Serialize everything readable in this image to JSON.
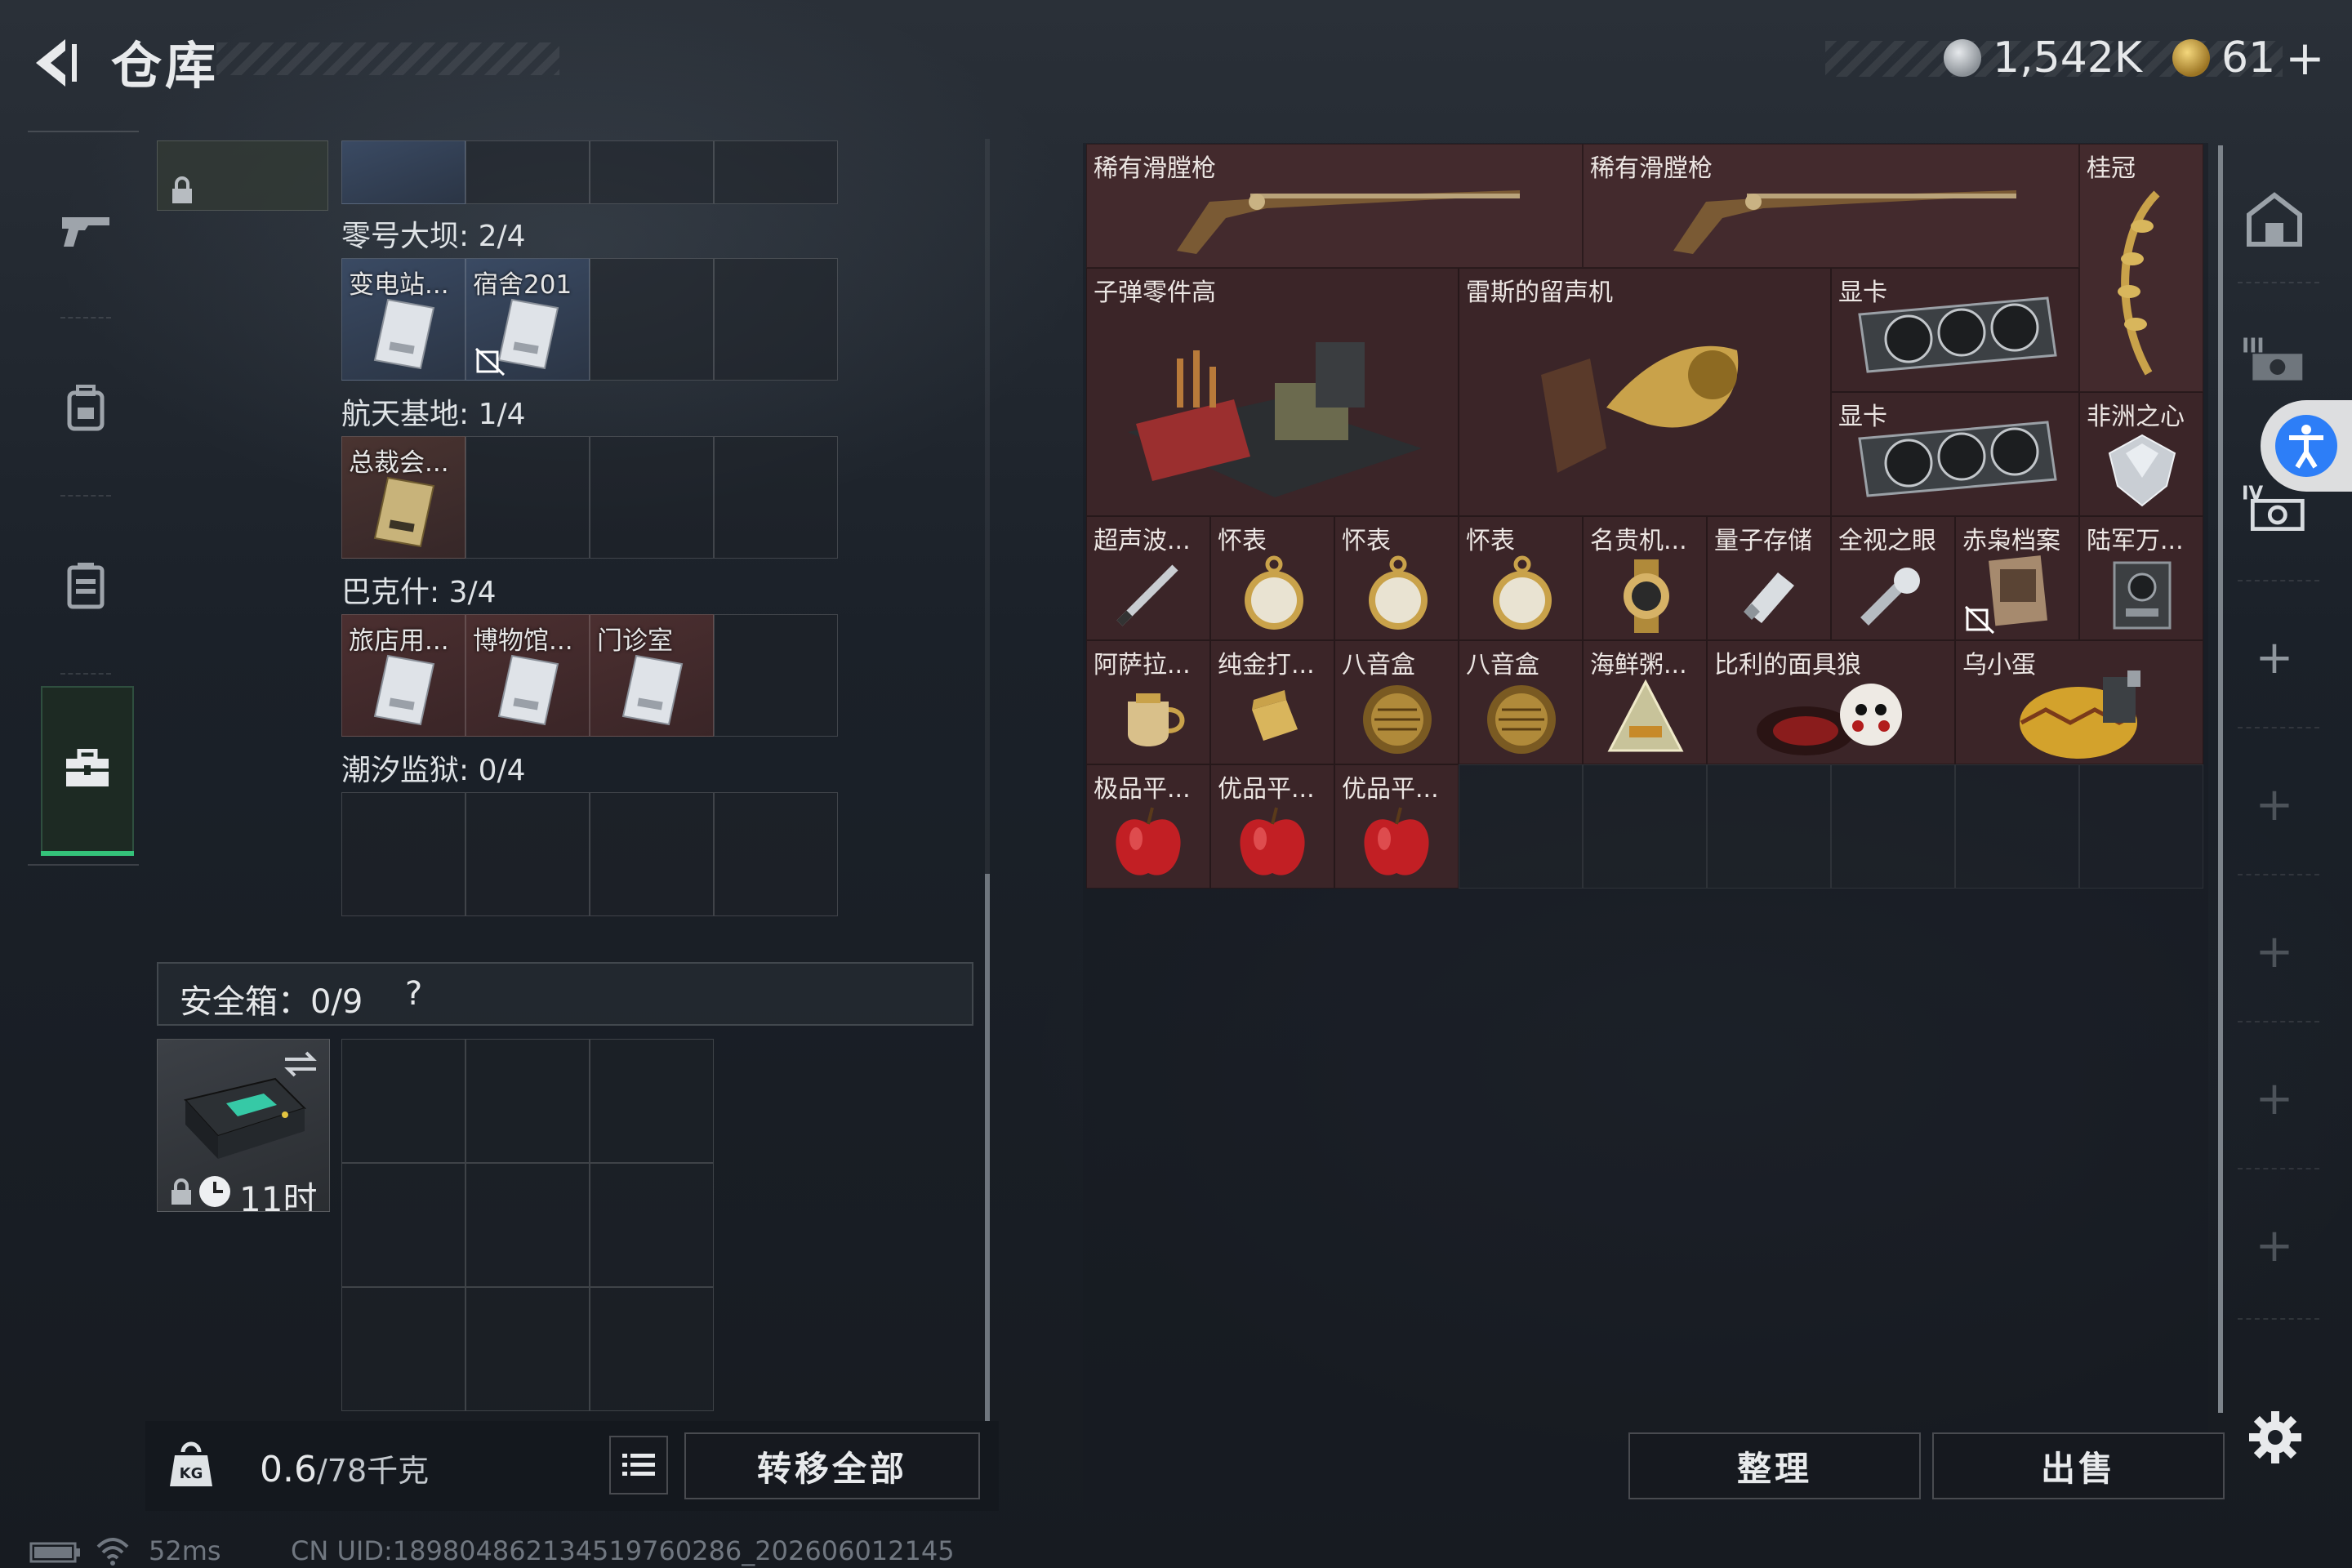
{
  "header": {
    "title": "仓库",
    "currency1": "1,542K",
    "currency2": "61",
    "add_symbol": "+"
  },
  "left_nav": {
    "tabs": [
      "gun-icon",
      "backpack-icon",
      "vest-icon",
      "toolbox-icon"
    ],
    "active": 3
  },
  "keycard_sections": [
    {
      "label": "零号大坝: 2/4",
      "items": [
        "变电站...",
        "宿舍201"
      ]
    },
    {
      "label": "航天基地: 1/4",
      "items": [
        "总裁会..."
      ]
    },
    {
      "label": "巴克什: 3/4",
      "items": [
        "旅店用...",
        "博物馆...",
        "门诊室"
      ]
    },
    {
      "label": "潮汐监狱: 0/4",
      "items": []
    }
  ],
  "safe": {
    "label": "安全箱：0/9",
    "help": "?",
    "timer": "11时"
  },
  "bottom_left": {
    "weight_value": "0.6",
    "weight_total": "/78千克",
    "transfer_all": "转移全部"
  },
  "right_items": {
    "rifle_1": "稀有滑膛枪",
    "rifle_2": "稀有滑膛枪",
    "laurel": "桂冠",
    "bullet_parts": "子弹零件高",
    "phonograph": "雷斯的留声机",
    "gpu_1": "显卡",
    "gpu_2": "显卡",
    "africa_heart": "非洲之心",
    "ultrasonic": "超声波...",
    "watch_1": "怀表",
    "watch_2": "怀表",
    "watch_3": "怀表",
    "famous_watch": "名贵机...",
    "quantum": "量子存储",
    "allseeing": "全视之眼",
    "redtide": "赤枭档案",
    "army": "陆军万...",
    "aroma": "阿萨拉...",
    "lighter": "纯金打...",
    "musicbox_1": "八音盒",
    "musicbox_2": "八音盒",
    "seafood": "海鲜粥...",
    "billy": "比利的面具狼",
    "egg": "乌小蛋",
    "apple_1": "极品平...",
    "apple_2": "优品平...",
    "apple_3": "优品平..."
  },
  "bottom_right": {
    "sort": "整理",
    "sell": "出售"
  },
  "status_bar": {
    "ping": "52ms",
    "uid": "CN UID:1898048621345197602​86_202606012145"
  },
  "colors": {
    "accent_green": "#34c27a",
    "item_bg_red": "#3b2528",
    "access_blue": "#2d7ef7"
  }
}
